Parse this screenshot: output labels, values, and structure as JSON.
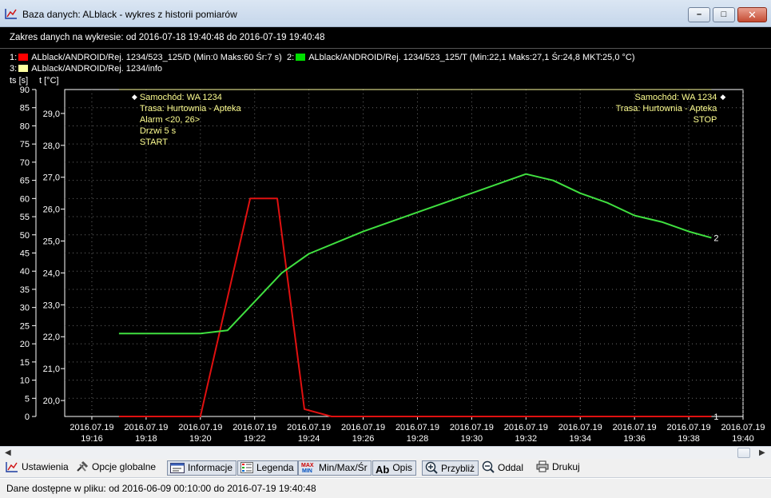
{
  "window": {
    "title": "Baza danych: ALblack - wykres z historii pomiarów",
    "buttons": {
      "minimize": "–",
      "maximize": "□",
      "close": "✕"
    }
  },
  "header": {
    "range_text": "Zakres danych na wykresie: od 2016-07-18 19:40:48 do 2016-07-19 19:40:48"
  },
  "legend": [
    {
      "index": "1:",
      "label": "ALblack/ANDROID/Rej. 1234/523_125/D (Min:0 Maks:60 Śr:7 s)",
      "color": "#ff0000"
    },
    {
      "index": "2:",
      "label": "ALblack/ANDROID/Rej. 1234/523_125/T (Min:22,1 Maks:27,1 Śr:24,8 MKT:25,0 °C)",
      "color": "#00e000"
    },
    {
      "index": "3:",
      "label": "ALblack/ANDROID/Rej. 1234/info",
      "color": "#ffffa0"
    }
  ],
  "axis_headers": {
    "left": "ts [s]",
    "right": "t [°C]"
  },
  "annotations": {
    "start": [
      "Samochód: WA 1234",
      "Trasa: Hurtownia - Apteka",
      "Alarm <20, 26>",
      "Drzwi 5 s",
      "START"
    ],
    "stop": [
      "Samochód: WA 1234",
      "Trasa: Hurtownia - Apteka",
      "STOP"
    ]
  },
  "chart_data": {
    "type": "line",
    "grid": true,
    "x_ticks": [
      [
        "2016.07.19",
        "19:16"
      ],
      [
        "2016.07.19",
        "19:18"
      ],
      [
        "2016.07.19",
        "19:20"
      ],
      [
        "2016.07.19",
        "19:22"
      ],
      [
        "2016.07.19",
        "19:24"
      ],
      [
        "2016.07.19",
        "19:26"
      ],
      [
        "2016.07.19",
        "19:28"
      ],
      [
        "2016.07.19",
        "19:30"
      ],
      [
        "2016.07.19",
        "19:32"
      ],
      [
        "2016.07.19",
        "19:34"
      ],
      [
        "2016.07.19",
        "19:36"
      ],
      [
        "2016.07.19",
        "19:38"
      ],
      [
        "2016.07.19",
        "19:40"
      ]
    ],
    "xlim": [
      "19:15",
      "19:40"
    ],
    "y_left": {
      "ticks": [
        "0",
        "5",
        "10",
        "15",
        "20",
        "25",
        "30",
        "35",
        "40",
        "45",
        "50",
        "55",
        "60",
        "65",
        "70",
        "75",
        "80",
        "85",
        "90"
      ],
      "ylim": [
        0,
        90
      ]
    },
    "y_right": {
      "ticks": [
        "20,0",
        "21,0",
        "22,0",
        "23,0",
        "24,0",
        "25,0",
        "26,0",
        "27,0",
        "28,0",
        "29,0"
      ],
      "ylim": [
        19.5,
        29.75
      ]
    },
    "series": [
      {
        "axis": "left",
        "color": "#e01010",
        "end_label": "1",
        "points": [
          [
            "19:17",
            0
          ],
          [
            "19:20",
            0
          ],
          [
            "19:21:50",
            60
          ],
          [
            "19:22:50",
            60
          ],
          [
            "19:23:50",
            2
          ],
          [
            "19:24:50",
            0
          ],
          [
            "19:38:50",
            0
          ]
        ]
      },
      {
        "axis": "right",
        "color": "#40e040",
        "end_label": "2",
        "points": [
          [
            "19:17",
            22.1
          ],
          [
            "19:20",
            22.1
          ],
          [
            "19:21",
            22.2
          ],
          [
            "19:23",
            24.0
          ],
          [
            "19:24",
            24.6
          ],
          [
            "19:26",
            25.3
          ],
          [
            "19:28",
            25.9
          ],
          [
            "19:30",
            26.5
          ],
          [
            "19:31",
            26.8
          ],
          [
            "19:32",
            27.1
          ],
          [
            "19:33",
            26.9
          ],
          [
            "19:34",
            26.5
          ],
          [
            "19:35",
            26.2
          ],
          [
            "19:36",
            25.8
          ],
          [
            "19:37",
            25.6
          ],
          [
            "19:38",
            25.3
          ],
          [
            "19:38:50",
            25.1
          ]
        ]
      },
      {
        "axis": "left",
        "color": "#ffffa0",
        "points": [
          [
            "19:17",
            90
          ],
          [
            "19:38:50",
            90
          ]
        ]
      }
    ]
  },
  "toolbar": {
    "settings": "Ustawienia",
    "global_options": "Opcje globalne",
    "info": "Informacje",
    "legend": "Legenda",
    "minmax": "Min/Max/Śr",
    "desc": "Opis",
    "zoom_in": "Przybliż",
    "zoom_out": "Oddal",
    "print": "Drukuj"
  },
  "status": {
    "text": "Dane dostępne w pliku: od 2016-06-09 00:10:00 do 2016-07-19 19:40:48"
  }
}
